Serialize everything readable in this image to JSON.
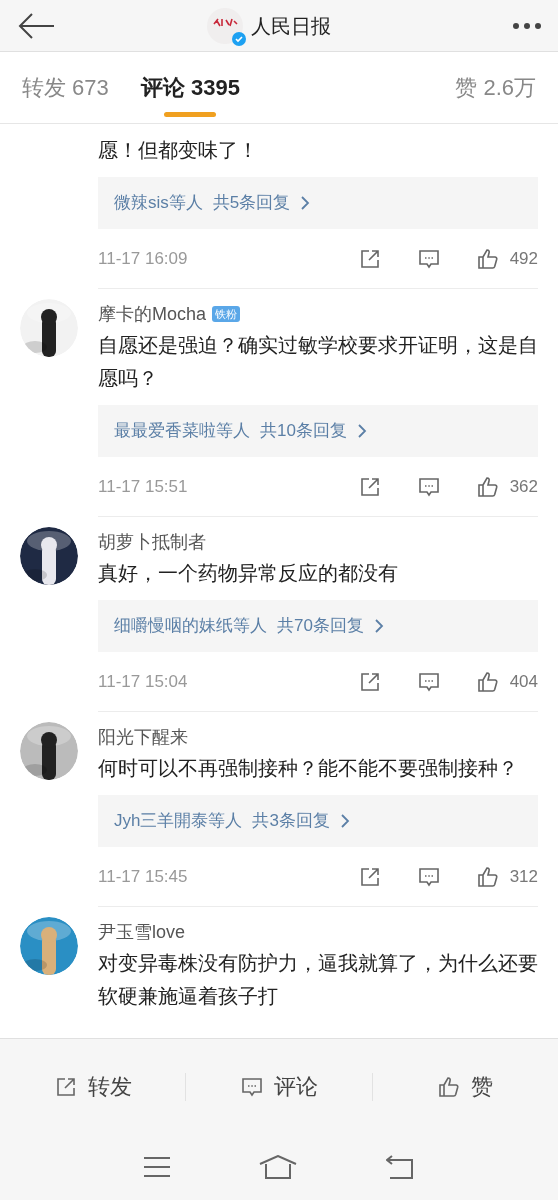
{
  "header": {
    "title": "人民日报",
    "verified": true
  },
  "tabs": [
    {
      "label": "转发 673",
      "selected": false
    },
    {
      "label": "评论 3395",
      "selected": true
    },
    {
      "label": "赞 2.6万",
      "selected": false
    }
  ],
  "comments": [
    {
      "text": "愿！但都变味了！",
      "reply_users": "微辣sis等人",
      "reply_count": "共5条回复",
      "time": "11-17 16:09",
      "likes": "492"
    },
    {
      "name": "摩卡的Mocha",
      "badge": "铁粉",
      "avatar": true,
      "text": "自愿还是强迫？确实过敏学校要求开证明，这是自愿吗？",
      "reply_users": "最最爱香菜啦等人",
      "reply_count": "共10条回复",
      "time": "11-17 15:51",
      "likes": "362"
    },
    {
      "name": "胡萝卜抵制者",
      "avatar": true,
      "text": "真好，一个药物异常反应的都没有",
      "reply_users": "细嚼慢咽的妹纸等人",
      "reply_count": "共70条回复",
      "time": "11-17 15:04",
      "likes": "404"
    },
    {
      "name": "阳光下醒来",
      "avatar": true,
      "text": "何时可以不再强制接种？能不能不要强制接种？",
      "reply_users": "Jyh三羊開泰等人",
      "reply_count": "共3条回复",
      "time": "11-17 15:45",
      "likes": "312"
    },
    {
      "name": "尹玉雪love",
      "avatar": true,
      "text": "对变异毒株没有防护力，逼我就算了，为什么还要软硬兼施逼着孩子打"
    }
  ],
  "actions": [
    {
      "kind": "repost",
      "label": "转发"
    },
    {
      "kind": "comment",
      "label": "评论"
    },
    {
      "kind": "like",
      "label": "赞"
    }
  ]
}
